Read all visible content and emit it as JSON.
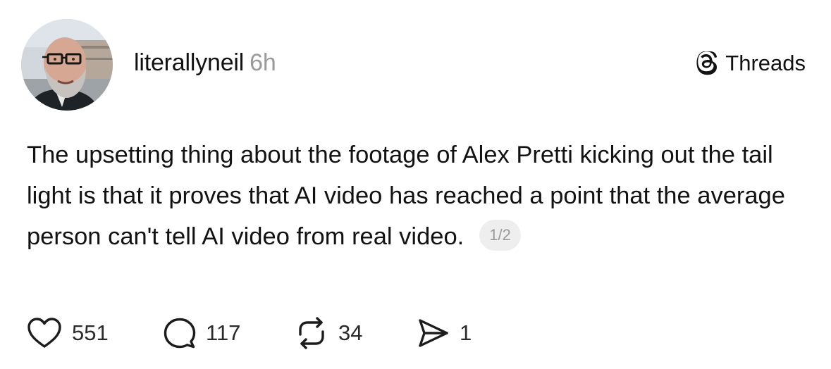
{
  "header": {
    "username": "literallyneil",
    "time": "6h",
    "brand": "Threads"
  },
  "post": {
    "text": "The upsetting thing about the footage of Alex Pretti kicking out the tail light is that it proves that AI video has reached a point that the average person can't tell AI video from real video.",
    "thread_position": "1/2"
  },
  "actions": {
    "likes": "551",
    "comments": "117",
    "reposts": "34",
    "shares": "1"
  },
  "icons": {
    "avatar": "profile-photo",
    "brand": "threads-logo-icon",
    "like": "heart-icon",
    "comment": "speech-bubble-icon",
    "repost": "repost-arrows-icon",
    "share": "paper-plane-icon"
  }
}
